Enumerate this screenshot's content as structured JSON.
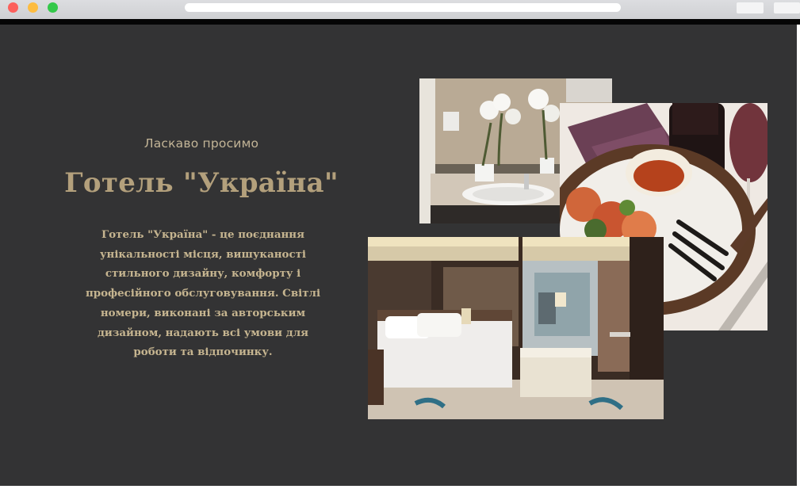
{
  "browser": {
    "window_buttons": [
      "close-dot",
      "minimize-dot",
      "maximize-dot"
    ]
  },
  "hero": {
    "welcome": "Ласкаво просимо",
    "title": "Готель \"Україна\"",
    "description": "Готель \"Україна\" - це поєднання унікальності місця, вишуканості стильного дизайну, комфорту і професійного обслуговування. Світлі номери, виконані за авторським дизайном, надають всі умови для роботи та відпочинку."
  },
  "gallery": [
    {
      "name": "bathroom-photo",
      "icon": "photo-icon"
    },
    {
      "name": "food-wine-photo",
      "icon": "photo-icon"
    },
    {
      "name": "bedroom-photo",
      "icon": "photo-icon"
    }
  ],
  "colors": {
    "background": "#333334",
    "heading": "#b3a07c",
    "text": "#c6b590"
  }
}
